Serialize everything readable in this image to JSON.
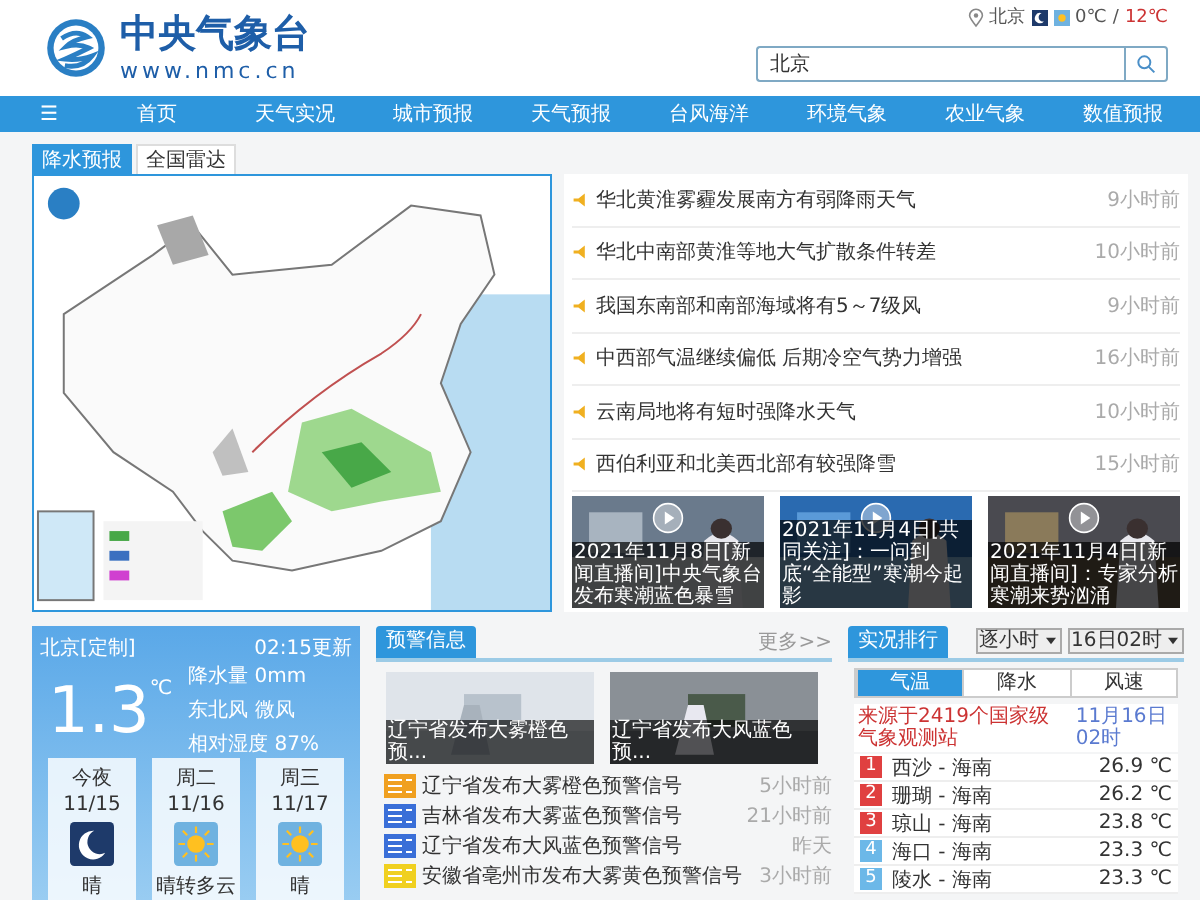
{
  "header": {
    "logo_title": "中央气象台",
    "logo_url": "www.nmc.cn",
    "location": "北京",
    "temp_low": "0℃",
    "separator": "/",
    "temp_high": "12℃",
    "search": {
      "value": "北京"
    }
  },
  "nav": [
    {
      "label": "☰",
      "kind": "menu"
    },
    {
      "label": "首页",
      "kind": "link"
    },
    {
      "label": "天气实况",
      "kind": "link"
    },
    {
      "label": "城市预报",
      "kind": "link"
    },
    {
      "label": "天气预报",
      "kind": "link"
    },
    {
      "label": "台风海洋",
      "kind": "link"
    },
    {
      "label": "环境气象",
      "kind": "link"
    },
    {
      "label": "农业气象",
      "kind": "link"
    },
    {
      "label": "数值预报",
      "kind": "link"
    }
  ],
  "map_tabs": [
    {
      "label": "降水预报",
      "selected": true
    },
    {
      "label": "全国雷达",
      "selected": false
    }
  ],
  "news": [
    {
      "title": "华北黄淮雾霾发展南方有弱降雨天气",
      "time": "9小时前"
    },
    {
      "title": "华北中南部黄淮等地大气扩散条件转差",
      "time": "10小时前"
    },
    {
      "title": "我国东南部和南部海域将有5～7级风",
      "time": "9小时前"
    },
    {
      "title": "中西部气温继续偏低 后期冷空气势力增强",
      "time": "16小时前"
    },
    {
      "title": "云南局地将有短时强降水天气",
      "time": "10小时前"
    },
    {
      "title": "西伯利亚和北美西北部有较强降雪",
      "time": "15小时前"
    }
  ],
  "videos": [
    {
      "caption": "2021年11月8日[新闻直播间]中央气象台发布寒潮蓝色暴雪"
    },
    {
      "caption": "2021年11月4日[共同关注]：一问到底“全能型”寒潮今起影"
    },
    {
      "caption": "2021年11月4日[新闻直播间]：专家分析寒潮来势汹涌"
    }
  ],
  "weather": {
    "location": "北京[定制]",
    "updated": "02:15更新",
    "temperature": "1.3",
    "unit": "℃",
    "rain": "降水量 0mm",
    "wind": "东北风 微风",
    "humidity": "相对湿度 87%",
    "days": [
      {
        "day": "今夜",
        "date": "11/15",
        "kind": "moon",
        "text": "晴"
      },
      {
        "day": "周二",
        "date": "11/16",
        "kind": "sun",
        "text": "晴转多云"
      },
      {
        "day": "周三",
        "date": "11/17",
        "kind": "sun",
        "text": "晴"
      }
    ]
  },
  "warnings": {
    "title": "预警信息",
    "more": "更多>>",
    "photos": [
      {
        "caption": "辽宁省发布大雾橙色预..."
      },
      {
        "caption": "辽宁省发布大风蓝色预..."
      }
    ],
    "items": [
      {
        "title": "辽宁省发布大雾橙色预警信号",
        "time": "5小时前",
        "color": "#f0a020"
      },
      {
        "title": "吉林省发布大雾蓝色预警信号",
        "time": "21小时前",
        "color": "#3a6fd8"
      },
      {
        "title": "辽宁省发布大风蓝色预警信号",
        "time": "昨天",
        "color": "#3a6fd8"
      },
      {
        "title": "安徽省亳州市发布大雾黄色预警信号",
        "time": "3小时前",
        "color": "#f0d020"
      }
    ]
  },
  "ranking": {
    "title": "实况排行",
    "period": "逐小时",
    "time_select": "16日02时",
    "tabs": [
      {
        "label": "气温",
        "selected": true
      },
      {
        "label": "降水",
        "selected": false
      },
      {
        "label": "风速",
        "selected": false
      }
    ],
    "source": "来源于2419个国家级气象观测站",
    "date": "11月16日02时",
    "rows": [
      {
        "rank": "1",
        "station": "西沙 - 海南",
        "value": "26.9 ℃",
        "color": "#e04040"
      },
      {
        "rank": "2",
        "station": "珊瑚 - 海南",
        "value": "26.2 ℃",
        "color": "#e04040"
      },
      {
        "rank": "3",
        "station": "琼山 - 海南",
        "value": "23.8 ℃",
        "color": "#e04040"
      },
      {
        "rank": "4",
        "station": "海口 - 海南",
        "value": "23.3 ℃",
        "color": "#6cb8e8"
      },
      {
        "rank": "5",
        "station": "陵水 - 海南",
        "value": "23.3 ℃",
        "color": "#6cb8e8"
      }
    ]
  }
}
